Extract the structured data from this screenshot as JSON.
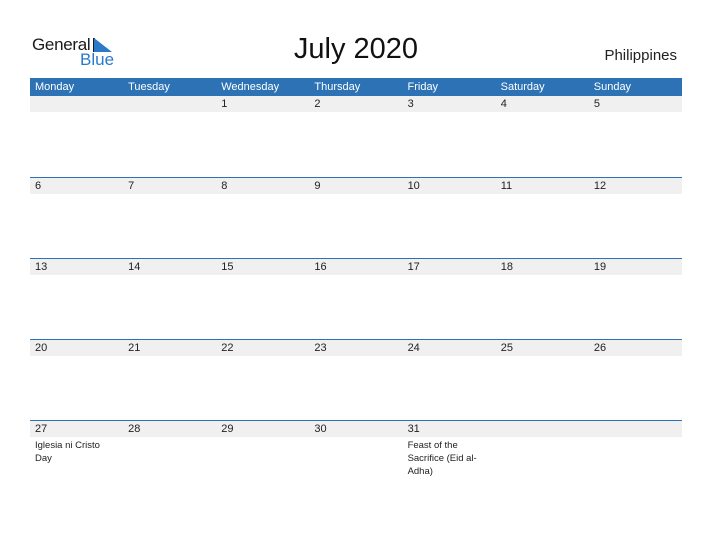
{
  "brand": {
    "line1": "General",
    "line2": "Blue",
    "accent_color": "#2d72b5"
  },
  "title": "July 2020",
  "country": "Philippines",
  "weekdays": [
    "Monday",
    "Tuesday",
    "Wednesday",
    "Thursday",
    "Friday",
    "Saturday",
    "Sunday"
  ],
  "weeks": [
    [
      {
        "day": ""
      },
      {
        "day": ""
      },
      {
        "day": "1"
      },
      {
        "day": "2"
      },
      {
        "day": "3"
      },
      {
        "day": "4"
      },
      {
        "day": "5"
      }
    ],
    [
      {
        "day": "6"
      },
      {
        "day": "7"
      },
      {
        "day": "8"
      },
      {
        "day": "9"
      },
      {
        "day": "10"
      },
      {
        "day": "11"
      },
      {
        "day": "12"
      }
    ],
    [
      {
        "day": "13"
      },
      {
        "day": "14"
      },
      {
        "day": "15"
      },
      {
        "day": "16"
      },
      {
        "day": "17"
      },
      {
        "day": "18"
      },
      {
        "day": "19"
      }
    ],
    [
      {
        "day": "20"
      },
      {
        "day": "21"
      },
      {
        "day": "22"
      },
      {
        "day": "23"
      },
      {
        "day": "24"
      },
      {
        "day": "25"
      },
      {
        "day": "26"
      }
    ],
    [
      {
        "day": "27",
        "event": "Iglesia ni Cristo Day"
      },
      {
        "day": "28"
      },
      {
        "day": "29"
      },
      {
        "day": "30"
      },
      {
        "day": "31",
        "event": "Feast of the Sacrifice (Eid al-Adha)"
      },
      {
        "day": ""
      },
      {
        "day": ""
      }
    ]
  ]
}
